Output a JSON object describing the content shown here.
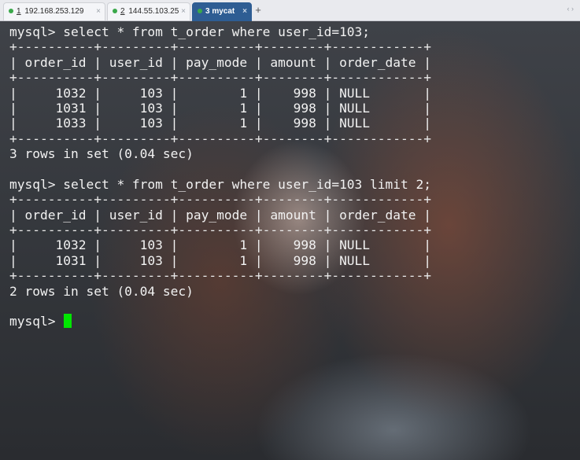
{
  "tabs": [
    {
      "num": "1",
      "label": "192.168.253.129",
      "state": "inactive"
    },
    {
      "num": "2",
      "label": "144.55.103.25",
      "state": "inactive"
    },
    {
      "num": "3",
      "label": "mycat",
      "state": "active"
    }
  ],
  "tab_close_glyph": "×",
  "add_tab_glyph": "+",
  "tab_scroll_glyph": "‹ ›",
  "colors": {
    "tab_dot": "#3aa84a",
    "active_tab": "#2e5d93",
    "cursor": "#00e600"
  },
  "terminal": {
    "lines": [
      "mysql> select * from t_order where user_id=103;",
      "+----------+---------+----------+--------+------------+",
      "| order_id | user_id | pay_mode | amount | order_date |",
      "+----------+---------+----------+--------+------------+",
      "|     1032 |     103 |        1 |    998 | NULL       |",
      "|     1031 |     103 |        1 |    998 | NULL       |",
      "|     1033 |     103 |        1 |    998 | NULL       |",
      "+----------+---------+----------+--------+------------+",
      "3 rows in set (0.04 sec)",
      "",
      "mysql> select * from t_order where user_id=103 limit 2;",
      "+----------+---------+----------+--------+------------+",
      "| order_id | user_id | pay_mode | amount | order_date |",
      "+----------+---------+----------+--------+------------+",
      "|     1032 |     103 |        1 |    998 | NULL       |",
      "|     1031 |     103 |        1 |    998 | NULL       |",
      "+----------+---------+----------+--------+------------+",
      "2 rows in set (0.04 sec)",
      "",
      "mysql> "
    ]
  }
}
